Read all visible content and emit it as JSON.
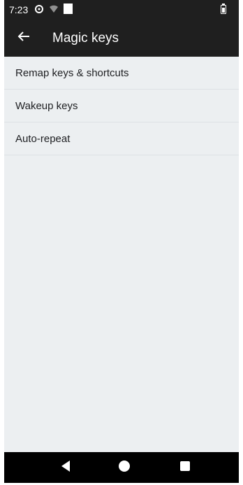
{
  "status_bar": {
    "time": "7:23",
    "icons": [
      "sync-icon",
      "wifi-icon",
      "notification-icon",
      "battery-icon"
    ]
  },
  "toolbar": {
    "title": "Magic keys",
    "back_icon": "arrow-back-icon"
  },
  "list": {
    "items": [
      {
        "label": "Remap keys & shortcuts"
      },
      {
        "label": "Wakeup keys"
      },
      {
        "label": "Auto-repeat"
      }
    ]
  },
  "nav_bar": {
    "icons": [
      "back-triangle-icon",
      "home-circle-icon",
      "recents-square-icon"
    ]
  },
  "colors": {
    "toolbar_bg": "#1f1f1f",
    "content_bg": "#eceff1",
    "nav_bg": "#000000"
  }
}
